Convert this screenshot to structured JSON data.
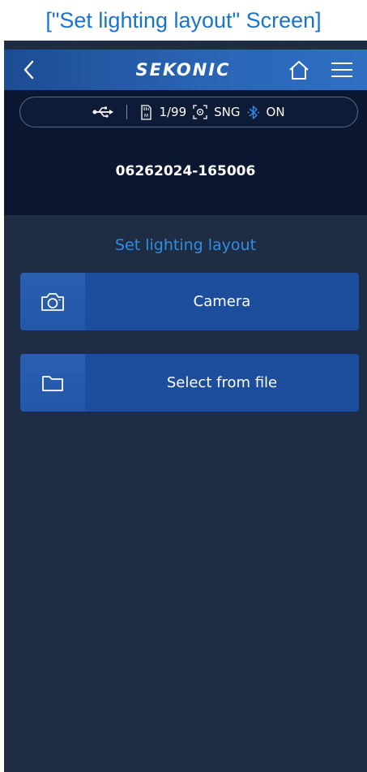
{
  "caption": "[\"Set lighting layout\" Screen]",
  "header": {
    "logo": "SEKONIC",
    "back_icon": "chevron-left-icon",
    "home_icon": "home-icon",
    "menu_icon": "hamburger-menu-icon"
  },
  "status": {
    "usb_icon": "usb-icon",
    "memory_icon": "memory-card-icon",
    "memory_count": "1/99",
    "mode_icon": "measure-mode-icon",
    "mode": "SNG",
    "bluetooth_icon": "bluetooth-icon",
    "bluetooth_state": "ON"
  },
  "file_id": "06262024-165006",
  "section_title": "Set lighting layout",
  "actions": [
    {
      "label": "Camera",
      "icon": "camera-icon"
    },
    {
      "label": "Select from file",
      "icon": "folder-icon"
    }
  ],
  "colors": {
    "accent": "#2f8ee6",
    "button": "#1d4e9e",
    "background": "#1e2c44",
    "top_band": "#0b1730"
  }
}
